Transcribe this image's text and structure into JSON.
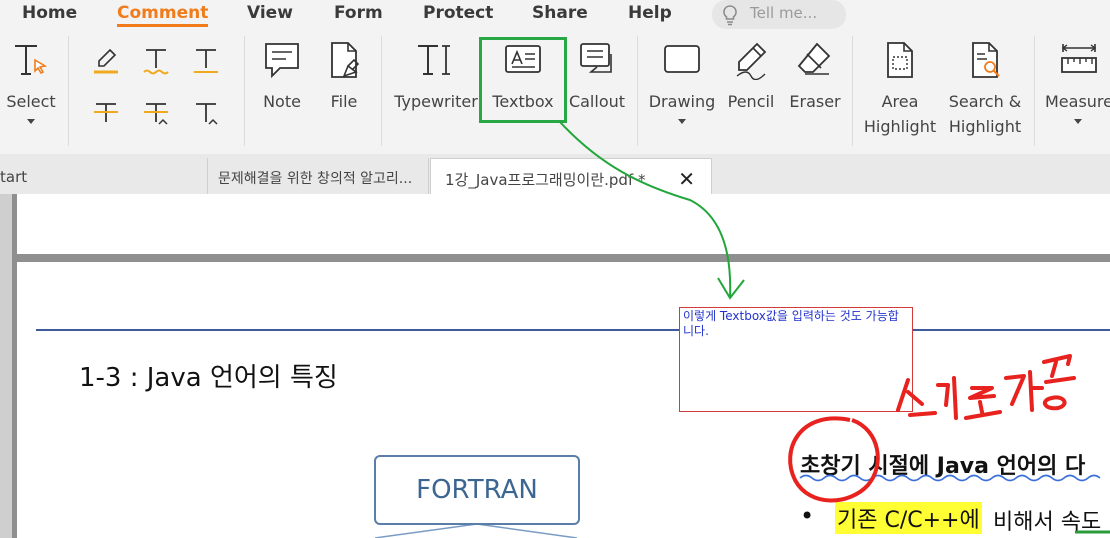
{
  "menu": {
    "items": [
      "Home",
      "Comment",
      "View",
      "Form",
      "Protect",
      "Share",
      "Help"
    ],
    "active": "Comment",
    "tell_me_placeholder": "Tell me..."
  },
  "ribbon": {
    "select": "Select",
    "note": "Note",
    "file": "File",
    "typewriter": "Typewriter",
    "textbox": "Textbox",
    "callout": "Callout",
    "drawing": "Drawing",
    "pencil": "Pencil",
    "eraser": "Eraser",
    "area_highlight_1": "Area",
    "area_highlight_2": "Highlight",
    "search_highlight_1": "Search &",
    "search_highlight_2": "Highlight",
    "measure": "Measure"
  },
  "tabs": {
    "tab1": "tart",
    "tab2": "문제해결을 위한 창의적 알고리...",
    "tab3": "1강_Java프로그래밍이란.pdf *"
  },
  "document": {
    "slide_title": "1-3 : Java 언어의 특징",
    "box_label": "FORTRAN",
    "heading": "초창기 시절에 Java 언어의 다",
    "bullet": "•",
    "bullet_highlight": "기존 C/C++에",
    "bullet_rest": "비해서 속도"
  },
  "annotation": {
    "textbox_text": "이렇게 Textbox값을 입력하는 것도 가능합니다.",
    "handwriting": "쓰기도가능"
  },
  "colors": {
    "accent": "#f07c1c",
    "highlight_frame": "#27a844",
    "ink_red": "#e8221f",
    "textbox_border": "#d23b3b",
    "annotation_text": "#2233cc",
    "text_highlight": "#ffff33"
  }
}
